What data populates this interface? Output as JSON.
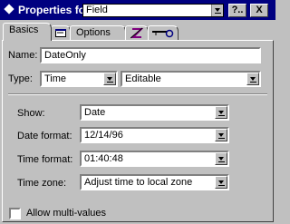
{
  "titlebar": {
    "title": "Properties for:",
    "selected_object": "Field",
    "help_button": "?..",
    "close_button": "X"
  },
  "tabs": [
    {
      "label": "Basics",
      "icon": null
    },
    {
      "label": "",
      "icon": "field-box-icon"
    },
    {
      "label": "Options",
      "icon": null
    },
    {
      "label": "",
      "icon": "paragraph-style-icon"
    },
    {
      "label": "",
      "icon": "key-icon"
    }
  ],
  "basics": {
    "name_label": "Name:",
    "name_value": "DateOnly",
    "type_label": "Type:",
    "type_value": "Time",
    "editable_value": "Editable",
    "show_label": "Show:",
    "show_value": "Date",
    "date_format_label": "Date format:",
    "date_format_value": "12/14/96",
    "time_format_label": "Time format:",
    "time_format_value": "01:40:48",
    "time_zone_label": "Time zone:",
    "time_zone_value": "Adjust time to local zone",
    "multi_values_label": "Allow multi-values",
    "multi_values_checked": false
  }
}
